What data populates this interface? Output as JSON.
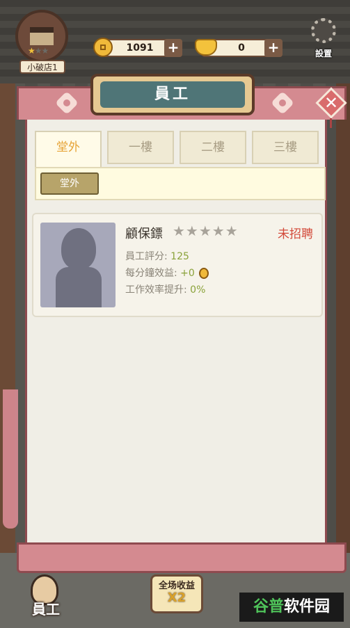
{
  "shop": {
    "name": "小破店1",
    "stars_filled": 1,
    "stars_total": 3
  },
  "resources": {
    "coins": "1091",
    "ingots": "0",
    "plus": "+"
  },
  "settings_label": "設置",
  "panel": {
    "title": "員工",
    "close_symbol": "✕"
  },
  "tabs": [
    {
      "label": "堂外",
      "active": true
    },
    {
      "label": "一樓",
      "active": false
    },
    {
      "label": "二樓",
      "active": false
    },
    {
      "label": "三樓",
      "active": false
    }
  ],
  "subtab": {
    "label": "堂外"
  },
  "staff": [
    {
      "name": "顧保鏢",
      "stars": "★★★★★",
      "status": "未招聘",
      "rating_label": "員工評分:",
      "rating_value": "125",
      "income_label": "每分鐘效益:",
      "income_value": "+0",
      "efficiency_label": "工作效率提升:",
      "efficiency_value": "0%"
    }
  ],
  "bottom": {
    "staff_label": "員工",
    "boost_line1": "全场收益",
    "boost_line2": "X2"
  },
  "watermark": {
    "part1": "谷普",
    "part2": "软件园"
  },
  "colors": {
    "accent_pink": "#d48a90",
    "title_teal": "#4f7577",
    "status_red": "#d34a3a",
    "value_green": "#8aa23a",
    "tab_active": "#e6a336"
  }
}
